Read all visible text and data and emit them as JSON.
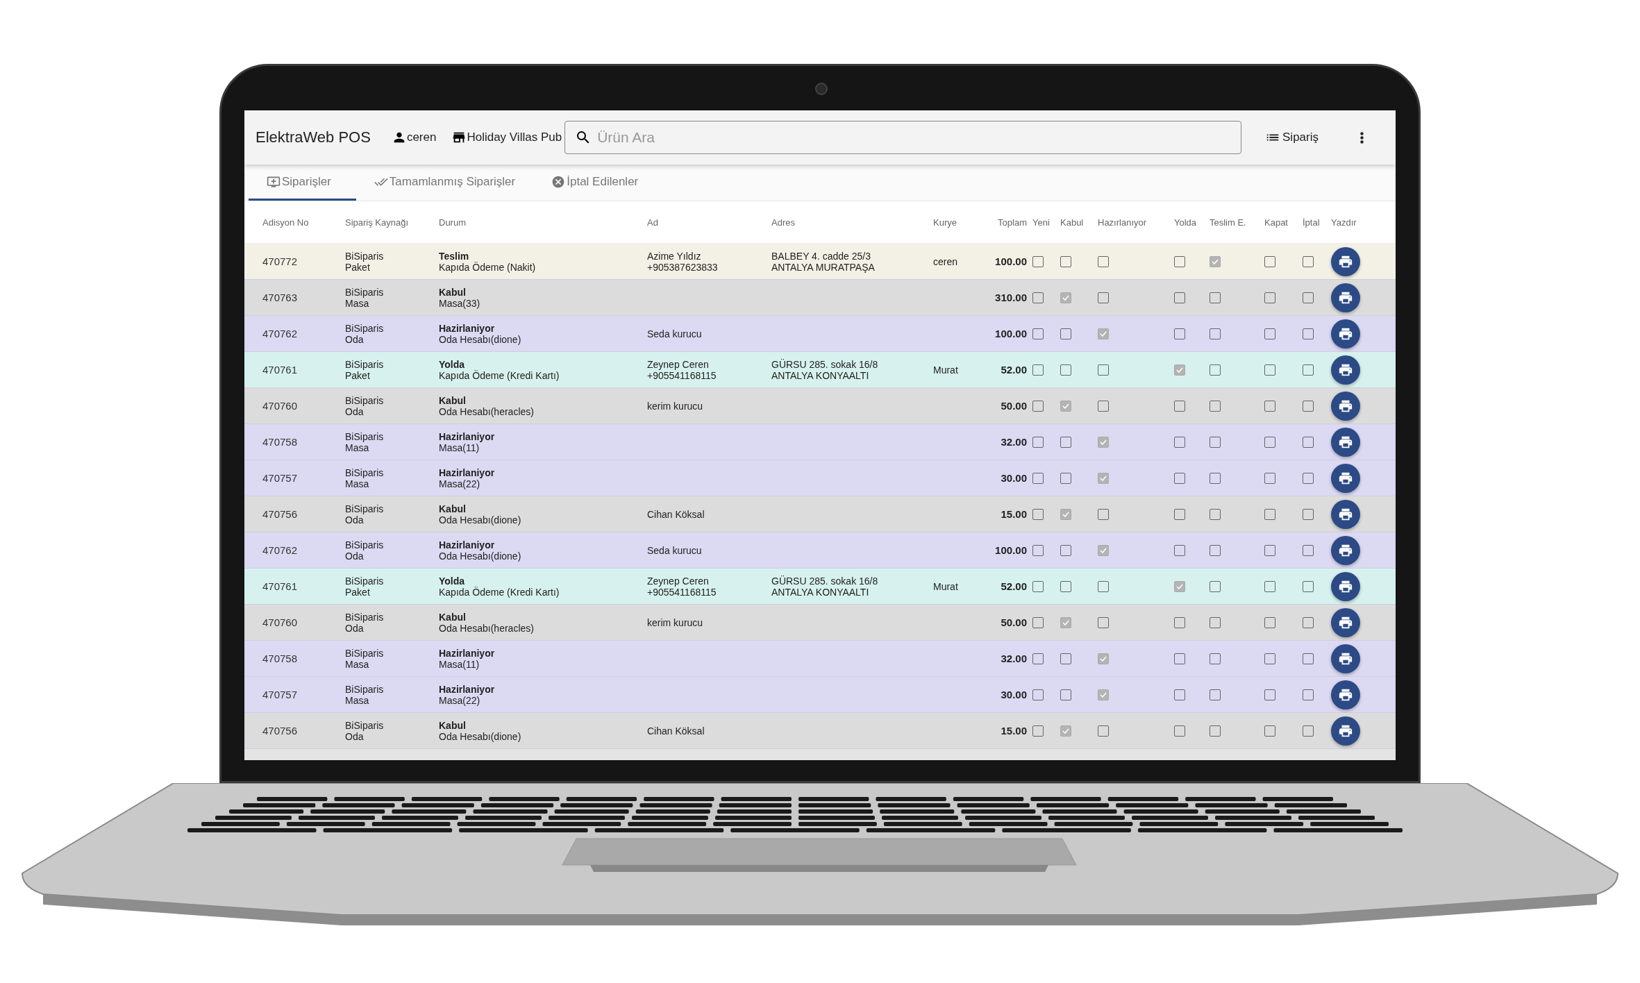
{
  "header": {
    "title": "ElektraWeb POS",
    "user": "ceren",
    "venue": "Holiday Villas Pub",
    "search": {
      "placeholder": "Ürün Ara"
    },
    "order_button": "Sipariş"
  },
  "tabs": [
    {
      "label": "Siparişler",
      "selected": true
    },
    {
      "label": "Tamamlanmış Siparişler",
      "selected": false
    },
    {
      "label": "İptal Edilenler",
      "selected": false
    }
  ],
  "table": {
    "columns": [
      "Adisyon No",
      "Sipariş Kaynağı",
      "Durum",
      "Ad",
      "Adres",
      "Kurye",
      "Toplam",
      "Yeni",
      "Kabul",
      "Hazırlanıyor",
      "Yolda",
      "Teslim E.",
      "Kapat",
      "İptal",
      "Yazdır"
    ],
    "rows": [
      {
        "no": "470772",
        "source": [
          "BiSiparis",
          "Paket"
        ],
        "status": "Teslim",
        "detail": "Kapıda Ödeme (Nakit)",
        "name": [
          "Azime Yıldız",
          "+905387623833"
        ],
        "address": [
          "BALBEY 4. cadde 25/3",
          "ANTALYA MURATPAŞA"
        ],
        "courier": "ceren",
        "total": "100.00",
        "color": "#f3f1e6",
        "checks": [
          false,
          false,
          false,
          false,
          true,
          false,
          false
        ]
      },
      {
        "no": "470763",
        "source": [
          "BiSiparis",
          "Masa"
        ],
        "status": "Kabul",
        "detail": "Masa(33)",
        "name": [],
        "address": [],
        "courier": "",
        "total": "310.00",
        "color": "#dcdcdc",
        "checks": [
          false,
          true,
          false,
          false,
          false,
          false,
          false
        ]
      },
      {
        "no": "470762",
        "source": [
          "BiSiparis",
          "Oda"
        ],
        "status": "Hazirlaniyor",
        "detail": "Oda Hesabı(dione)",
        "name": [
          "Seda kurucu"
        ],
        "address": [],
        "courier": "",
        "total": "100.00",
        "color": "#dcd9f2",
        "checks": [
          false,
          false,
          true,
          false,
          false,
          false,
          false
        ]
      },
      {
        "no": "470761",
        "source": [
          "BiSiparis",
          "Paket"
        ],
        "status": "Yolda",
        "detail": "Kapıda Ödeme (Kredi Kartı)",
        "name": [
          "Zeynep Ceren",
          "+905541168115"
        ],
        "address": [
          "GÜRSU 285. sokak 16/8",
          "ANTALYA KONYAALTI"
        ],
        "courier": "Murat",
        "total": "52.00",
        "color": "#d7f2ee",
        "checks": [
          false,
          false,
          false,
          true,
          false,
          false,
          false
        ]
      },
      {
        "no": "470760",
        "source": [
          "BiSiparis",
          "Oda"
        ],
        "status": "Kabul",
        "detail": "Oda Hesabı(heracles)",
        "name": [
          "kerim kurucu"
        ],
        "address": [],
        "courier": "",
        "total": "50.00",
        "color": "#dcdcdc",
        "checks": [
          false,
          true,
          false,
          false,
          false,
          false,
          false
        ]
      },
      {
        "no": "470758",
        "source": [
          "BiSiparis",
          "Masa"
        ],
        "status": "Hazirlaniyor",
        "detail": "Masa(11)",
        "name": [],
        "address": [],
        "courier": "",
        "total": "32.00",
        "color": "#dcd9f2",
        "checks": [
          false,
          false,
          true,
          false,
          false,
          false,
          false
        ]
      },
      {
        "no": "470757",
        "source": [
          "BiSiparis",
          "Masa"
        ],
        "status": "Hazirlaniyor",
        "detail": "Masa(22)",
        "name": [],
        "address": [],
        "courier": "",
        "total": "30.00",
        "color": "#dcd9f2",
        "checks": [
          false,
          false,
          true,
          false,
          false,
          false,
          false
        ]
      },
      {
        "no": "470756",
        "source": [
          "BiSiparis",
          "Oda"
        ],
        "status": "Kabul",
        "detail": "Oda Hesabı(dione)",
        "name": [
          "Cihan Köksal"
        ],
        "address": [],
        "courier": "",
        "total": "15.00",
        "color": "#dcdcdc",
        "checks": [
          false,
          true,
          false,
          false,
          false,
          false,
          false
        ]
      },
      {
        "no": "470762",
        "source": [
          "BiSiparis",
          "Oda"
        ],
        "status": "Hazirlaniyor",
        "detail": "Oda Hesabı(dione)",
        "name": [
          "Seda kurucu"
        ],
        "address": [],
        "courier": "",
        "total": "100.00",
        "color": "#dcd9f2",
        "checks": [
          false,
          false,
          true,
          false,
          false,
          false,
          false
        ]
      },
      {
        "no": "470761",
        "source": [
          "BiSiparis",
          "Paket"
        ],
        "status": "Yolda",
        "detail": "Kapıda Ödeme (Kredi Kartı)",
        "name": [
          "Zeynep Ceren",
          "+905541168115"
        ],
        "address": [
          "GÜRSU 285. sokak 16/8",
          "ANTALYA KONYAALTI"
        ],
        "courier": "Murat",
        "total": "52.00",
        "color": "#d7f2ee",
        "checks": [
          false,
          false,
          false,
          true,
          false,
          false,
          false
        ]
      },
      {
        "no": "470760",
        "source": [
          "BiSiparis",
          "Oda"
        ],
        "status": "Kabul",
        "detail": "Oda Hesabı(heracles)",
        "name": [
          "kerim kurucu"
        ],
        "address": [],
        "courier": "",
        "total": "50.00",
        "color": "#dcdcdc",
        "checks": [
          false,
          true,
          false,
          false,
          false,
          false,
          false
        ]
      },
      {
        "no": "470758",
        "source": [
          "BiSiparis",
          "Masa"
        ],
        "status": "Hazirlaniyor",
        "detail": "Masa(11)",
        "name": [],
        "address": [],
        "courier": "",
        "total": "32.00",
        "color": "#dcd9f2",
        "checks": [
          false,
          false,
          true,
          false,
          false,
          false,
          false
        ]
      },
      {
        "no": "470757",
        "source": [
          "BiSiparis",
          "Masa"
        ],
        "status": "Hazirlaniyor",
        "detail": "Masa(22)",
        "name": [],
        "address": [],
        "courier": "",
        "total": "30.00",
        "color": "#dcd9f2",
        "checks": [
          false,
          false,
          true,
          false,
          false,
          false,
          false
        ]
      },
      {
        "no": "470756",
        "source": [
          "BiSiparis",
          "Oda"
        ],
        "status": "Kabul",
        "detail": "Oda Hesabı(dione)",
        "name": [
          "Cihan Köksal"
        ],
        "address": [],
        "courier": "",
        "total": "15.00",
        "color": "#dcdcdc",
        "checks": [
          false,
          true,
          false,
          false,
          false,
          false,
          false
        ]
      }
    ]
  }
}
